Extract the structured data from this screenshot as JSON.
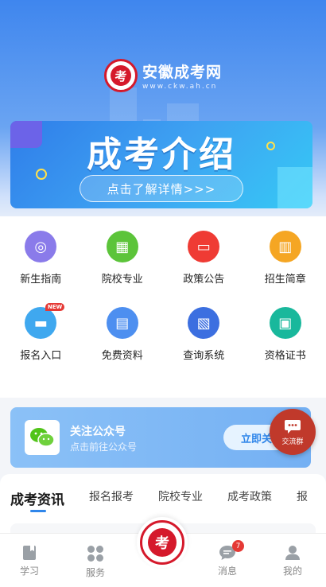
{
  "header": {
    "site_name": "安徽成考网",
    "site_url": "www.ckw.ah.cn",
    "logo_glyph": "考"
  },
  "banner": {
    "title": "成考介绍",
    "button_label": "点击了解详情>>>"
  },
  "grid": {
    "items": [
      {
        "label": "新生指南",
        "icon": "compass-icon",
        "color": "#8a7bea",
        "glyph": "◎"
      },
      {
        "label": "院校专业",
        "icon": "building-icon",
        "color": "#5cc43a",
        "glyph": "▦"
      },
      {
        "label": "政策公告",
        "icon": "laptop-icon",
        "color": "#ef3b34",
        "glyph": "▭"
      },
      {
        "label": "招生简章",
        "icon": "brochure-icon",
        "color": "#f5a623",
        "glyph": "▥"
      },
      {
        "label": "报名入口",
        "icon": "monitor-icon",
        "color": "#3fa8ef",
        "glyph": "▬",
        "tag": "NEW"
      },
      {
        "label": "免费资料",
        "icon": "book-icon",
        "color": "#4d8ff0",
        "glyph": "▤"
      },
      {
        "label": "查询系统",
        "icon": "document-search-icon",
        "color": "#3c6fe0",
        "glyph": "▧"
      },
      {
        "label": "资格证书",
        "icon": "certificate-icon",
        "color": "#19b89c",
        "glyph": "▣"
      }
    ]
  },
  "follow": {
    "title": "关注公众号",
    "subtitle": "点击前往公众号",
    "button_label": "立即关"
  },
  "chat": {
    "label": "交流群"
  },
  "news": {
    "tabs": [
      "成考资讯",
      "报名报考",
      "院校专业",
      "成考政策",
      "报"
    ]
  },
  "tabbar": {
    "items": [
      {
        "label": "学习",
        "icon": "study-icon"
      },
      {
        "label": "服务",
        "icon": "grid-icon"
      },
      {
        "label": "消息",
        "icon": "message-icon",
        "badge": "7"
      },
      {
        "label": "我的",
        "icon": "profile-icon"
      }
    ],
    "center_glyph": "考"
  },
  "colors": {
    "brand_red": "#d5192b",
    "accent_blue": "#2f86ea"
  }
}
